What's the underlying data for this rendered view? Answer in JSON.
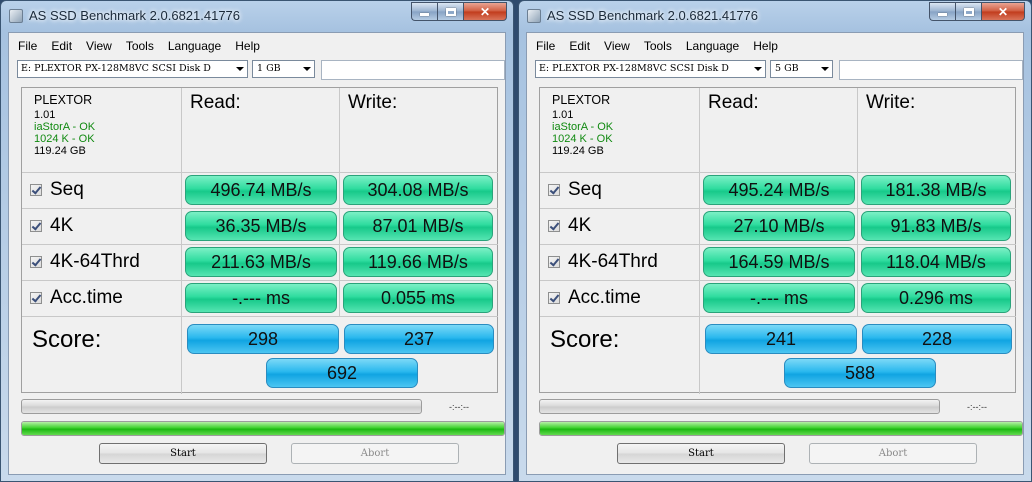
{
  "windows": [
    {
      "title": "AS SSD Benchmark 2.0.6821.41776",
      "menu": [
        "File",
        "Edit",
        "View",
        "Tools",
        "Language",
        "Help"
      ],
      "drive": "E: PLEXTOR PX-128M8VC SCSI Disk D",
      "size": "1 GB",
      "info": {
        "vendor": "PLEXTOR",
        "firmware": "1.01",
        "driver": "iaStorA - OK",
        "alignment": "1024 K - OK",
        "capacity": "119.24 GB"
      },
      "headers": {
        "read": "Read:",
        "write": "Write:"
      },
      "rows": [
        {
          "label": "Seq",
          "read": "496.74 MB/s",
          "write": "304.08 MB/s"
        },
        {
          "label": "4K",
          "read": "36.35 MB/s",
          "write": "87.01 MB/s"
        },
        {
          "label": "4K-64Thrd",
          "read": "211.63 MB/s",
          "write": "119.66 MB/s"
        },
        {
          "label": "Acc.time",
          "read": "-.--- ms",
          "write": "0.055 ms"
        }
      ],
      "score": {
        "label": "Score:",
        "read": "298",
        "write": "237",
        "total": "692"
      },
      "time": "-:--:--",
      "total_progress": 1.0,
      "buttons": {
        "start": "Start",
        "abort": "Abort"
      }
    },
    {
      "title": "AS SSD Benchmark 2.0.6821.41776",
      "menu": [
        "File",
        "Edit",
        "View",
        "Tools",
        "Language",
        "Help"
      ],
      "drive": "E: PLEXTOR PX-128M8VC SCSI Disk D",
      "size": "5 GB",
      "info": {
        "vendor": "PLEXTOR",
        "firmware": "1.01",
        "driver": "iaStorA - OK",
        "alignment": "1024 K - OK",
        "capacity": "119.24 GB"
      },
      "headers": {
        "read": "Read:",
        "write": "Write:"
      },
      "rows": [
        {
          "label": "Seq",
          "read": "495.24 MB/s",
          "write": "181.38 MB/s"
        },
        {
          "label": "4K",
          "read": "27.10 MB/s",
          "write": "91.83 MB/s"
        },
        {
          "label": "4K-64Thrd",
          "read": "164.59 MB/s",
          "write": "118.04 MB/s"
        },
        {
          "label": "Acc.time",
          "read": "-.--- ms",
          "write": "0.296 ms"
        }
      ],
      "score": {
        "label": "Score:",
        "read": "241",
        "write": "228",
        "total": "588"
      },
      "time": "-:--:--",
      "total_progress": 1.0,
      "buttons": {
        "start": "Start",
        "abort": "Abort"
      }
    }
  ],
  "colors": {
    "result_green": "#2fdc9f",
    "score_blue": "#2ab8ee",
    "progress_green": "#3fd22e",
    "ok_text": "#118a11"
  },
  "icons": {
    "app": "app-icon",
    "checkbox": "checkbox-checked-icon",
    "dropdown": "chevron-down-icon"
  }
}
